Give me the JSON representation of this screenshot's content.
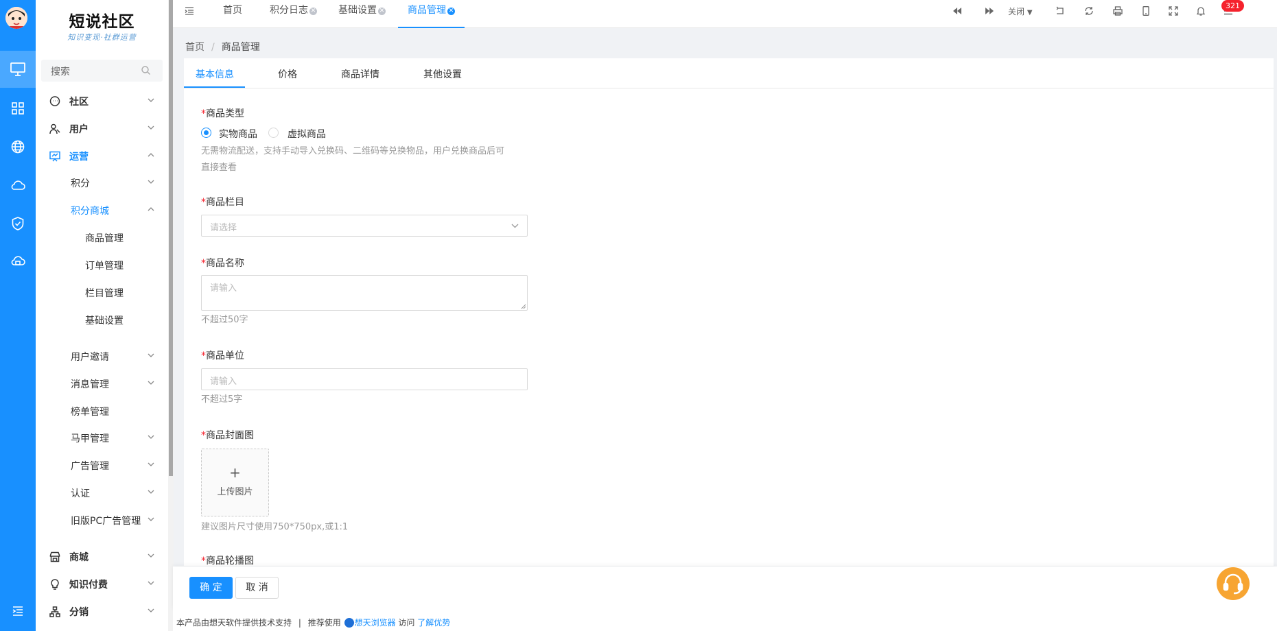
{
  "rail": {
    "icons": [
      "avatar",
      "monitor-icon",
      "grid-icon",
      "globe-icon",
      "cloud-icon",
      "shield-check-icon",
      "cloud-app-icon",
      "menu-fold-icon"
    ],
    "bg": "#1890ff"
  },
  "logo": {
    "title": "短说社区",
    "slogan": "知识变现·社群运营"
  },
  "sidebar": {
    "search_placeholder": "搜索",
    "items": [
      {
        "label": "社区",
        "icon": "chat-icon"
      },
      {
        "label": "用户",
        "icon": "user-icon"
      },
      {
        "label": "运营",
        "icon": "presentation-icon"
      },
      {
        "label": "积分"
      },
      {
        "label": "积分商城"
      },
      {
        "label": "商品管理"
      },
      {
        "label": "订单管理"
      },
      {
        "label": "栏目管理"
      },
      {
        "label": "基础设置"
      },
      {
        "label": "用户邀请"
      },
      {
        "label": "消息管理"
      },
      {
        "label": "榜单管理"
      },
      {
        "label": "马甲管理"
      },
      {
        "label": "广告管理"
      },
      {
        "label": "认证"
      },
      {
        "label": "旧版PC广告管理"
      },
      {
        "label": "商城",
        "icon": "shop-icon"
      },
      {
        "label": "知识付费",
        "icon": "bulb-icon"
      },
      {
        "label": "分销",
        "icon": "sitemap-icon"
      }
    ]
  },
  "tabs": [
    {
      "label": "首页"
    },
    {
      "label": "积分日志"
    },
    {
      "label": "基础设置"
    },
    {
      "label": "商品管理"
    }
  ],
  "toolbar": {
    "close_label": "关闭",
    "notification_count": "321"
  },
  "breadcrumb": {
    "home": "首页",
    "sep": "/",
    "current": "商品管理"
  },
  "form_tabs": [
    "基本信息",
    "价格",
    "商品详情",
    "其他设置"
  ],
  "form": {
    "required_mark": "*",
    "type": {
      "label": "商品类型",
      "options": [
        "实物商品",
        "虚拟商品"
      ],
      "selected": "实物商品",
      "hint_line1": "无需物流配送，支持手动导入兑换码、二维码等兑换物品，用户兑换商品后可",
      "hint_line2": "直接查看"
    },
    "category": {
      "label": "商品栏目",
      "placeholder": "请选择"
    },
    "name": {
      "label": "商品名称",
      "placeholder": "请输入",
      "hint": "不超过50字"
    },
    "unit": {
      "label": "商品单位",
      "placeholder": "请输入",
      "hint": "不超过5字"
    },
    "cover": {
      "label": "商品封面图",
      "upload_label": "上传图片",
      "plus": "+",
      "hint": "建议图片尺寸使用750*750px,或1:1"
    },
    "carousel": {
      "label": "商品轮播图"
    }
  },
  "actions": {
    "confirm": "确 定",
    "cancel": "取 消"
  },
  "footer": {
    "text1": "本产品由想天软件提供技术支持",
    "divider": "|",
    "text2": "推荐使用",
    "browser": "想天浏览器",
    "text3": "访问",
    "link": "了解优势"
  },
  "colors": {
    "primary": "#1890ff",
    "required": "#f5222d",
    "support": "#f7a532"
  }
}
